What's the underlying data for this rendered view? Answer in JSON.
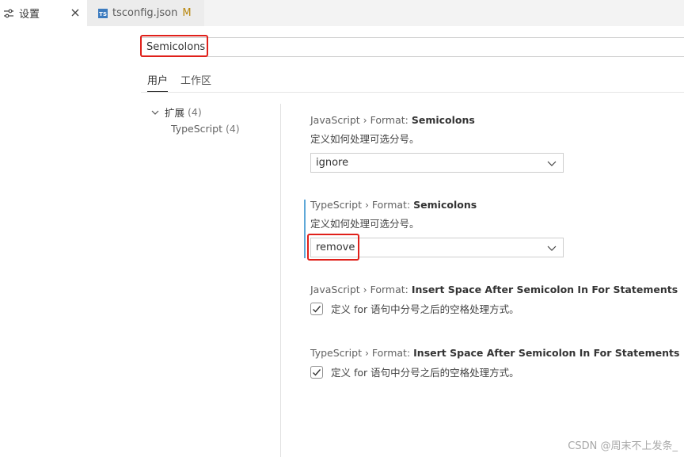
{
  "tabs": [
    {
      "label": "设置",
      "icon": "settings-sliders-icon",
      "close": "close-icon"
    },
    {
      "label": "tsconfig.json",
      "icon_text": "TS",
      "badge": "M"
    }
  ],
  "search": {
    "value": "Semicolons"
  },
  "scope_tabs": [
    "用户",
    "工作区"
  ],
  "toc": [
    {
      "label": "扩展",
      "count": "(4)"
    },
    {
      "label": "TypeScript",
      "count": "(4)"
    }
  ],
  "settings": [
    {
      "category": "JavaScript › Format: ",
      "name": "Semicolons",
      "desc": "定义如何处理可选分号。",
      "value": "ignore"
    },
    {
      "category": "TypeScript › Format: ",
      "name": "Semicolons",
      "desc": "定义如何处理可选分号。",
      "value": "remove"
    },
    {
      "category": "JavaScript › Format: ",
      "name": "Insert Space After Semicolon In For Statements",
      "desc": "定义 for 语句中分号之后的空格处理方式。",
      "checked": true
    },
    {
      "category": "TypeScript › Format: ",
      "name": "Insert Space After Semicolon In For Statements",
      "desc": "定义 for 语句中分号之后的空格处理方式。",
      "checked": true
    }
  ],
  "watermark": "CSDN @周末不上发条_",
  "colors": {
    "highlight": "#e0201a",
    "modified_indicator": "#5ea8d8",
    "ts_icon": "#3c7bbf"
  }
}
